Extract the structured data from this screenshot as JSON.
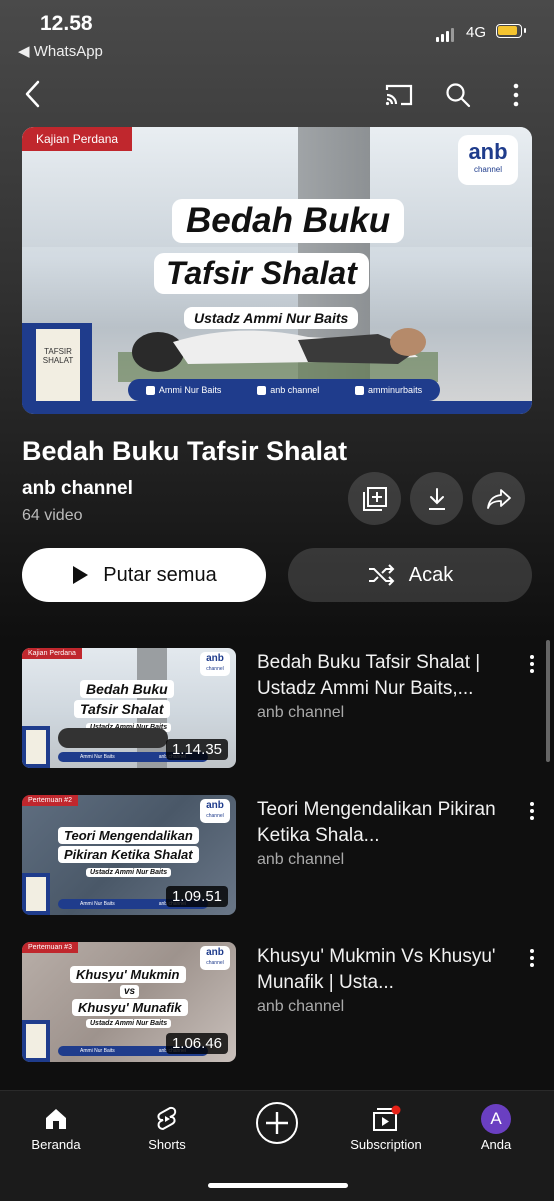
{
  "status_bar": {
    "time": "12.58",
    "back_app": "◀ WhatsApp",
    "network": "4G"
  },
  "hero": {
    "tag": "Kajian Perdana",
    "logo_main": "anb",
    "logo_sub": "channel",
    "title_line1": "Bedah Buku",
    "title_line2": "Tafsir Shalat",
    "speaker": "Ustadz Ammi Nur Baits",
    "book_cover": "TAFSIR SHALAT",
    "social": [
      "Ammi Nur Baits",
      "anb channel",
      "amminurbaits"
    ]
  },
  "playlist": {
    "title": "Bedah Buku Tafsir Shalat",
    "channel": "anb channel",
    "count": "64 video",
    "play_all": "Putar semua",
    "shuffle": "Acak"
  },
  "videos": [
    {
      "thumb_tag": "Kajian Perdana",
      "thumb_line1": "Bedah Buku",
      "thumb_line2": "Tafsir Shalat",
      "thumb_speaker": "Ustadz Ammi Nur Baits",
      "duration": "1.14.35",
      "title": "Bedah Buku Tafsir Shalat | Ustadz Ammi Nur Baits,...",
      "channel": "anb channel"
    },
    {
      "thumb_tag": "Pertemuan #2",
      "thumb_line1": "Teori Mengendalikan",
      "thumb_line2": "Pikiran Ketika Shalat",
      "thumb_speaker": "Ustadz Ammi Nur Baits",
      "duration": "1.09.51",
      "title": "Teori Mengendalikan Pikiran Ketika Shala...",
      "channel": "anb channel"
    },
    {
      "thumb_tag": "Pertemuan #3",
      "thumb_line1": "Khusyu' Mukmin",
      "thumb_vs": "vs",
      "thumb_line2": "Khusyu' Munafik",
      "thumb_speaker": "Ustadz Ammi Nur Baits",
      "duration": "1.06.46",
      "title": "Khusyu' Mukmin Vs Khusyu' Munafik | Usta...",
      "channel": "anb channel"
    }
  ],
  "nav": {
    "home": "Beranda",
    "shorts": "Shorts",
    "subscription": "Subscription",
    "you": "Anda",
    "avatar_letter": "A"
  },
  "colors": {
    "brand_red": "#c0272d",
    "brand_blue": "#1f3c8c",
    "avatar": "#6a3fc1"
  }
}
